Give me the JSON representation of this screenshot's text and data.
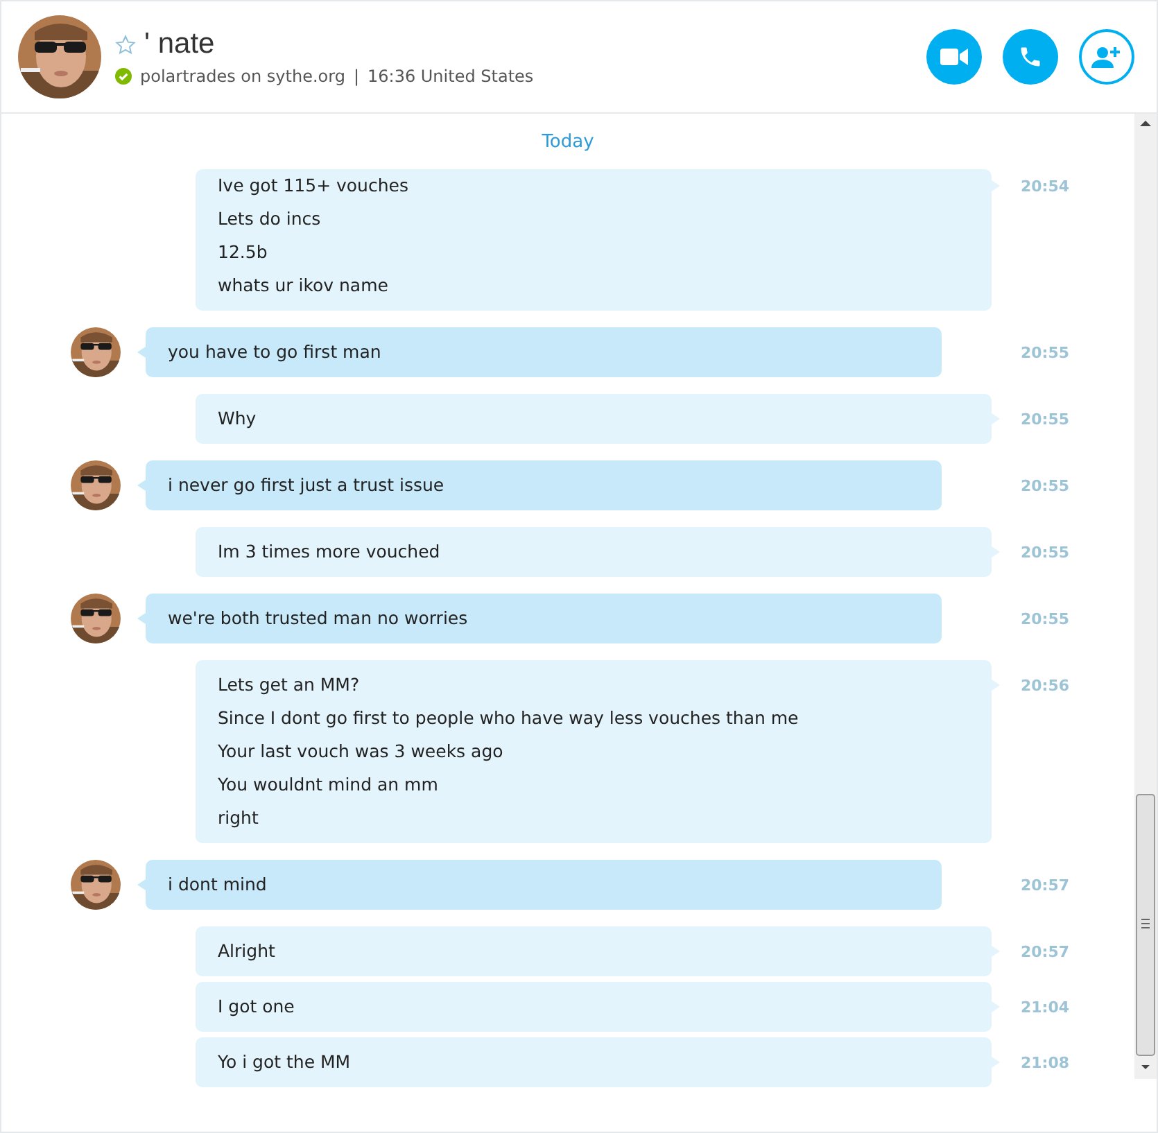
{
  "contact": {
    "name": "' nate",
    "favorite": false,
    "online": true,
    "mood": "polartrades on sythe.org",
    "separator": "|",
    "local_info": "16:36 United States"
  },
  "day_divider": "Today",
  "messages": [
    {
      "kind": "outgoing",
      "lines": [
        "Ive got 115+ vouches",
        "Lets do incs",
        "12.5b",
        "whats ur ikov name"
      ],
      "time": "20:54"
    },
    {
      "kind": "incoming",
      "lines": [
        "you have to go first man"
      ],
      "time": "20:55"
    },
    {
      "kind": "outgoing",
      "lines": [
        "Why"
      ],
      "time": "20:55"
    },
    {
      "kind": "incoming",
      "lines": [
        "i never go first just a trust issue"
      ],
      "time": "20:55"
    },
    {
      "kind": "outgoing",
      "lines": [
        "Im 3 times more vouched"
      ],
      "time": "20:55"
    },
    {
      "kind": "incoming",
      "lines": [
        "we're both trusted man no worries"
      ],
      "time": "20:55"
    },
    {
      "kind": "outgoing",
      "lines": [
        "Lets get an MM?",
        "Since I dont go first to people who have way less vouches than me",
        "Your last vouch was 3 weeks ago",
        "You wouldnt mind an mm",
        "right"
      ],
      "time": "20:56"
    },
    {
      "kind": "incoming",
      "lines": [
        "i dont mind"
      ],
      "time": "20:57"
    },
    {
      "kind": "outgoing",
      "lines": [
        "Alright"
      ],
      "time": "20:57"
    },
    {
      "kind": "outgoing",
      "lines": [
        "I got one"
      ],
      "time": "21:04"
    },
    {
      "kind": "outgoing",
      "lines": [
        "Yo i got the MM"
      ],
      "time": "21:08"
    }
  ]
}
